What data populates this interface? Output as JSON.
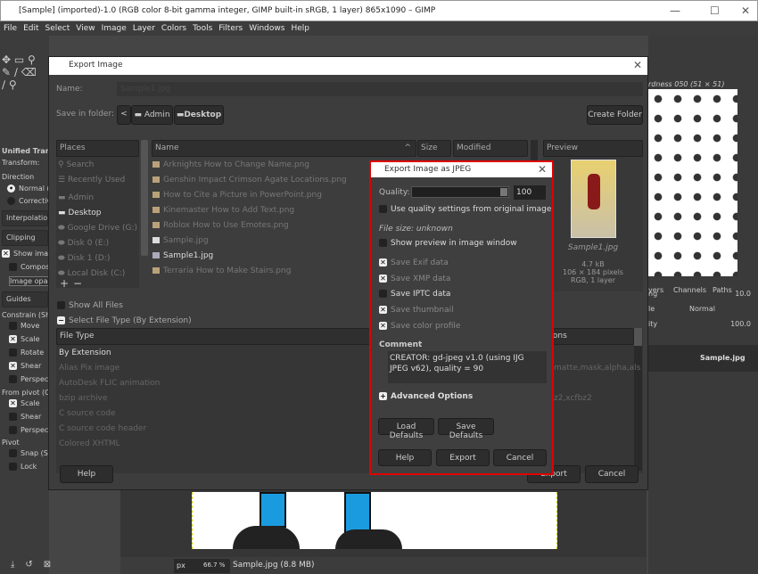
{
  "window": {
    "title": "[Sample] (imported)-1.0 (RGB color 8-bit gamma integer, GIMP built-in sRGB, 1 layer) 865x1090 – GIMP",
    "minimize": "—",
    "maximize": "☐",
    "close": "✕"
  },
  "menu": [
    "File",
    "Edit",
    "Select",
    "View",
    "Image",
    "Layer",
    "Colors",
    "Tools",
    "Filters",
    "Windows",
    "Help"
  ],
  "toolbox": {
    "title": "Unified Trans",
    "transform": "Transform:",
    "direction": "Direction",
    "normal": "Normal (",
    "corrective": "Correctiv",
    "interpolation": "Interpolation",
    "clipping": "Clipping",
    "show_image": "Show imag",
    "composite": "Composi",
    "image_opacity": "Image opaci",
    "guides": "Guides",
    "constrain": "Constrain (Shif",
    "move": "Move",
    "scale": "Scale",
    "rotate": "Rotate",
    "shear": "Shear",
    "perspective": "Perspect",
    "from_pivot": "From pivot  (Ct",
    "fp_scale": "Scale",
    "fp_shear": "Shear",
    "fp_perspective": "Perspect",
    "pivot": "Pivot",
    "snap": "Snap (Sh",
    "lock": "Lock"
  },
  "export": {
    "title": "Export Image",
    "name_label": "Name:",
    "name_value": "Sample1.jpg",
    "folder_label": "Save in folder:",
    "back": "<",
    "crumbs": [
      "Admin",
      "Desktop"
    ],
    "create_folder": "Create Folder",
    "places_header": "Places",
    "places": [
      "Search",
      "Recently Used",
      "Admin",
      "Desktop",
      "Google Drive (G:)",
      "Disk 0 (E:)",
      "Disk 1 (D:)",
      "Local Disk (C:)"
    ],
    "add": "+",
    "remove": "−",
    "columns": {
      "name": "Name",
      "size": "Size",
      "modified": "Modified"
    },
    "files": [
      "Arknights How to Change Name.png",
      "Genshin Impact Crimson Agate Locations.png",
      "How to Cite a Picture in PowerPoint.png",
      "Kinemaster How to Add Text.png",
      "Roblox How to Use Emotes.png",
      "Sample.jpg",
      "Sample1.jpg",
      "Terraria How to Make Stairs.png"
    ],
    "preview": {
      "header": "Preview",
      "filename": "Sample1.jpg",
      "size": "4.7 kB",
      "dims": "106 × 184 pixels",
      "info": "RGB, 1 layer"
    },
    "show_all_files": "Show All Files",
    "select_type": "Select File Type (By Extension)",
    "type_header": "File Type",
    "ext_header": "nsions",
    "types": [
      "By Extension",
      "Alias Pix image",
      "AutoDesk FLIC animation",
      "bzip archive",
      "C source code",
      "C source code header",
      "Colored XHTML"
    ],
    "exts": [
      "",
      "matte,mask,alpha,als",
      "",
      "z2,xcfbz2",
      "",
      "",
      ""
    ],
    "help": "Help",
    "export": "Export",
    "cancel": "Cancel"
  },
  "jpeg": {
    "title": "Export Image as JPEG",
    "quality_label": "Quality:",
    "quality": 100,
    "use_orig": "Use quality settings from original image",
    "file_size": "File size: unknown",
    "show_preview": "Show preview in image window",
    "save_exif": "Save Exif data",
    "save_xmp": "Save XMP data",
    "save_iptc": "Save IPTC data",
    "save_thumb": "Save thumbnail",
    "save_profile": "Save color profile",
    "comment_label": "Comment",
    "comment": "CREATOR: gd-jpeg v1.0 (using IJG JPEG v62), quality = 90",
    "advanced": "Advanced Options",
    "load_defaults": "Load Defaults",
    "save_defaults": "Save Defaults",
    "help": "Help",
    "export": "Export",
    "cancel": "Cancel"
  },
  "right": {
    "brush_name": "rdness 050 (51 × 51)",
    "spacing_label": "ng",
    "spacing": "10.0",
    "tabs": [
      "yers",
      "Channels",
      "Paths"
    ],
    "mode_label": "le",
    "mode": "Normal",
    "opacity_label": "ity",
    "opacity": "100.0",
    "layer": "Sample.jpg"
  },
  "status": {
    "unit": "px",
    "zoom": "66.7 %",
    "file": "Sample.jpg (8.8 MB)"
  },
  "colors": {
    "highlight": "#e00000",
    "bg": "#454545"
  }
}
